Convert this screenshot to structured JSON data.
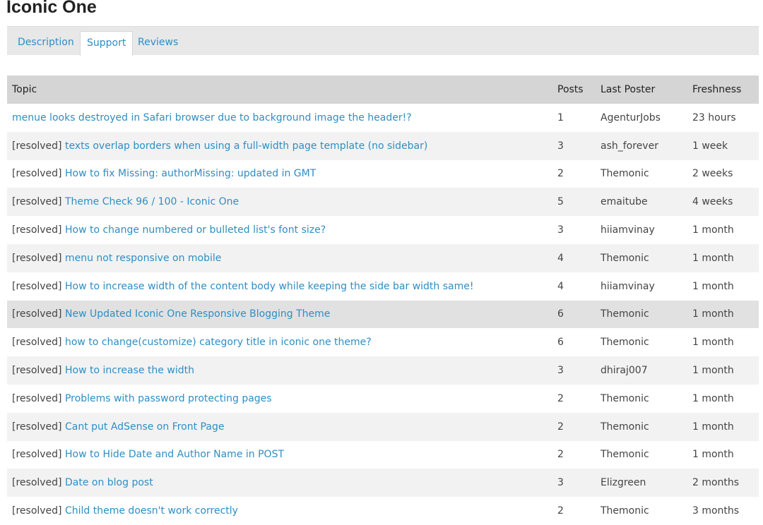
{
  "page": {
    "title": "Iconic One"
  },
  "tabs": [
    {
      "label": "Description",
      "active": false
    },
    {
      "label": "Support",
      "active": true
    },
    {
      "label": "Reviews",
      "active": false
    }
  ],
  "table": {
    "headers": {
      "topic": "Topic",
      "posts": "Posts",
      "last_poster": "Last Poster",
      "freshness": "Freshness"
    },
    "rows": [
      {
        "prefix": "",
        "title": "menue looks destroyed in Safari browser due to background image the header!?",
        "posts": "1",
        "last_poster": "AgenturJobs",
        "freshness": "23 hours"
      },
      {
        "prefix": "[resolved]",
        "title": "texts overlap borders when using a full-width page template (no sidebar)",
        "posts": "3",
        "last_poster": "ash_forever",
        "freshness": "1 week"
      },
      {
        "prefix": "[resolved]",
        "title": "How to fix Missing: authorMissing: updated in GMT",
        "posts": "2",
        "last_poster": "Themonic",
        "freshness": "2 weeks"
      },
      {
        "prefix": "[resolved]",
        "title": "Theme Check 96 / 100 - Iconic One",
        "posts": "5",
        "last_poster": "emaitube",
        "freshness": "4 weeks"
      },
      {
        "prefix": "[resolved]",
        "title": "How to change numbered or bulleted list's font size?",
        "posts": "3",
        "last_poster": "hiiamvinay",
        "freshness": "1 month"
      },
      {
        "prefix": "[resolved]",
        "title": "menu not responsive on mobile",
        "posts": "4",
        "last_poster": "Themonic",
        "freshness": "1 month"
      },
      {
        "prefix": "[resolved]",
        "title": "How to increase width of the content body while keeping the side bar width same!",
        "posts": "4",
        "last_poster": "hiiamvinay",
        "freshness": "1 month"
      },
      {
        "prefix": "[resolved]",
        "title": "New Updated Iconic One Responsive Blogging Theme",
        "posts": "6",
        "last_poster": "Themonic",
        "freshness": "1 month"
      },
      {
        "prefix": "[resolved]",
        "title": "how to change(customize) category title in iconic one theme?",
        "posts": "6",
        "last_poster": "Themonic",
        "freshness": "1 month"
      },
      {
        "prefix": "[resolved]",
        "title": "How to increase the width",
        "posts": "3",
        "last_poster": "dhiraj007",
        "freshness": "1 month"
      },
      {
        "prefix": "[resolved]",
        "title": "Problems with password protecting pages",
        "posts": "2",
        "last_poster": "Themonic",
        "freshness": "1 month"
      },
      {
        "prefix": "[resolved]",
        "title": "Cant put AdSense on Front Page",
        "posts": "2",
        "last_poster": "Themonic",
        "freshness": "1 month"
      },
      {
        "prefix": "[resolved]",
        "title": "How to Hide Date and Author Name in POST",
        "posts": "2",
        "last_poster": "Themonic",
        "freshness": "1 month"
      },
      {
        "prefix": "[resolved]",
        "title": "Date on blog post",
        "posts": "3",
        "last_poster": "Elizgreen",
        "freshness": "2 months"
      },
      {
        "prefix": "[resolved]",
        "title": "Child theme doesn't work correctly",
        "posts": "2",
        "last_poster": "Themonic",
        "freshness": "3 months"
      }
    ]
  },
  "colors": {
    "link": "#2e8ec4",
    "header_bg": "#d5d5d5",
    "stripe_bg": "#f2f2f2",
    "highlight_bg": "#e1e1e1"
  }
}
